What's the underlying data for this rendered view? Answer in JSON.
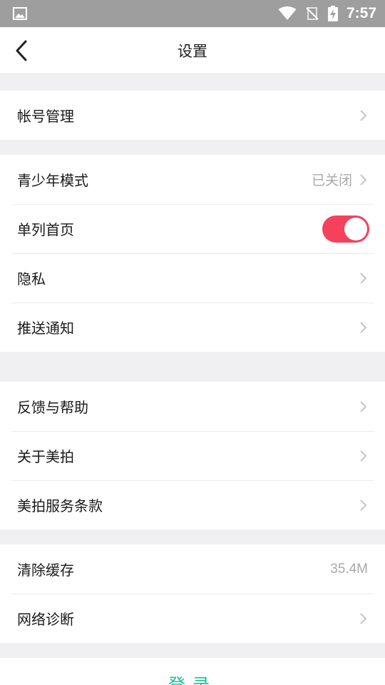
{
  "status_bar": {
    "time": "7:57"
  },
  "header": {
    "title": "设置"
  },
  "groups": [
    {
      "items": [
        {
          "label": "帐号管理"
        }
      ]
    },
    {
      "items": [
        {
          "label": "青少年模式",
          "value": "已关闭"
        },
        {
          "label": "单列首页",
          "toggle_on": true
        },
        {
          "label": "隐私"
        },
        {
          "label": "推送通知"
        }
      ]
    },
    {
      "items": [
        {
          "label": "反馈与帮助"
        },
        {
          "label": "关于美拍"
        },
        {
          "label": "美拍服务条款"
        }
      ]
    },
    {
      "items": [
        {
          "label": "清除缓存",
          "value": "35.4M"
        },
        {
          "label": "网络诊断"
        }
      ]
    }
  ],
  "login": {
    "label": "登录"
  },
  "colors": {
    "accent_toggle": "#f5415c",
    "login_text": "#19c29a",
    "status_bar": "#9e9e9e"
  }
}
